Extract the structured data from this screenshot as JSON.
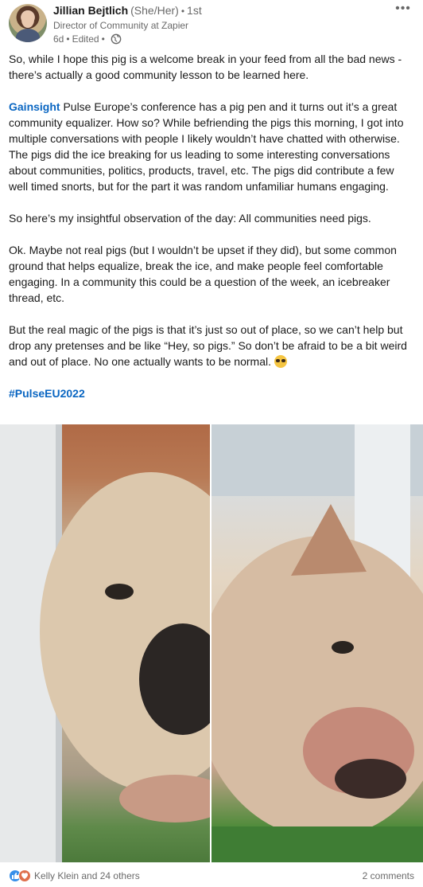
{
  "author": {
    "name": "Jillian Bejtlich",
    "pronouns": "(She/Her)",
    "degree": "1st",
    "headline": "Director of Community at Zapier",
    "time": "6d",
    "edited": "Edited",
    "visibility_icon": "globe-icon",
    "avatar_icon": "avatar"
  },
  "menu": {
    "icon": "more-options-icon",
    "label": "•••"
  },
  "post": {
    "p1": "So, while I hope this pig is a welcome break in your feed from all the bad news - there’s actually a good community lesson to be learned here.",
    "p2_link": "Gainsight",
    "p2_rest": " Pulse Europe’s conference has a pig pen and it turns out it’s a great community equalizer. How so? While befriending the pigs this morning, I got into multiple conversations with people I likely wouldn’t have chatted with otherwise. The pigs did the ice breaking for us leading to some interesting conversations about communities, politics, products, travel, etc. The pigs did contribute a few well timed snorts, but for the part it was random unfamiliar humans engaging.",
    "p3": "So here’s my insightful observation of the day: All communities need pigs.",
    "p4": "Ok. Maybe not real pigs (but I wouldn’t be upset if they did), but some common ground that helps equalize, break the ice, and make people feel comfortable engaging. In a community this could be a question of the week, an icebreaker thread, etc.",
    "p5": "But the real magic of the pigs is that it’s just so out of place, so we can’t help but drop any pretenses and be like “Hey, so pigs.” So don’t be afraid to be a bit weird and out of place. No one actually wants to be normal.",
    "p5_emoji": "nerd-face-emoji",
    "hashtag": "#PulseEU2022"
  },
  "images": [
    {
      "name": "pig-photo-left"
    },
    {
      "name": "pig-photo-right"
    }
  ],
  "social": {
    "reactions_text": "Kelly Klein and 24 others",
    "comments_text": "2 comments",
    "like_color": "#378fe9",
    "love_color": "#df704d"
  },
  "colors": {
    "link": "#0a66c2"
  }
}
